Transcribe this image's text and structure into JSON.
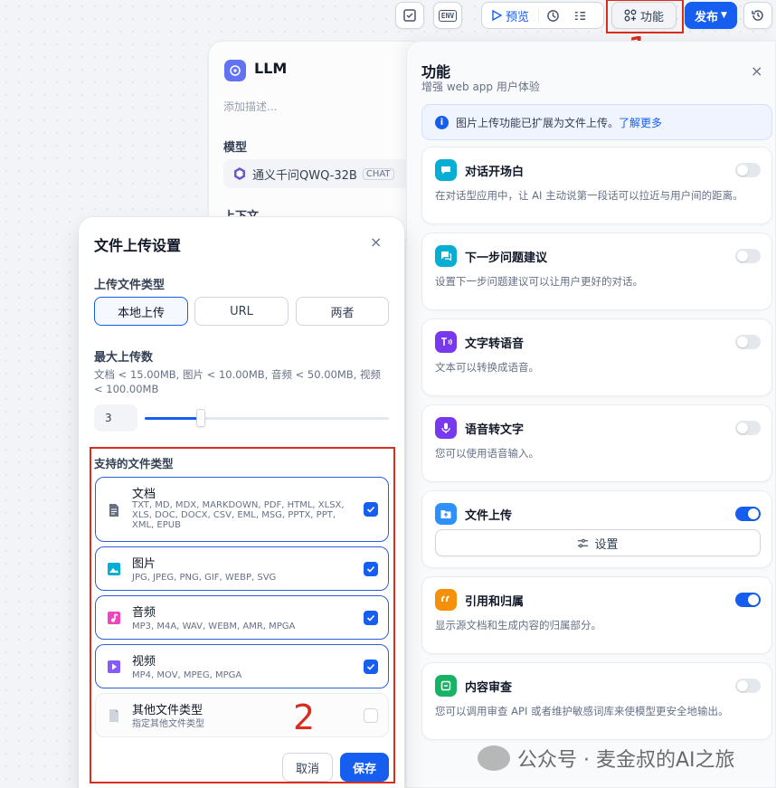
{
  "toolbar": {
    "preview_label": "预览",
    "features_label": "功能",
    "publish_label": "发布",
    "env_label": "ENV"
  },
  "annotations": {
    "n1": "1",
    "n2": "2"
  },
  "llm_node": {
    "title": "LLM",
    "description_placeholder": "添加描述...",
    "model_label": "模型",
    "model_name": "通义千问QWQ-32B",
    "model_badge": "CHAT",
    "context_label": "上下文"
  },
  "upload_modal": {
    "title": "文件上传设置",
    "close": "×",
    "upload_type_label": "上传文件类型",
    "upload_types": [
      "本地上传",
      "URL",
      "两者"
    ],
    "selected_upload_type": "本地上传",
    "max_upload_label": "最大上传数",
    "limit_text": "文档 < 15.00MB, 图片 < 10.00MB, 音频 < 50.00MB, 视频 < 100.00MB",
    "max_upload_value": "3",
    "max_upload_fraction": 0.23,
    "supported_label": "支持的文件类型",
    "file_types": [
      {
        "name": "文档",
        "extensions": "TXT, MD, MDX, MARKDOWN, PDF, HTML, XLSX, XLS, DOC, DOCX, CSV, EML, MSG, PPTX, PPT, XML, EPUB",
        "checked": true,
        "icon": "document-icon",
        "color": "#667085"
      },
      {
        "name": "图片",
        "extensions": "JPG, JPEG, PNG, GIF, WEBP, SVG",
        "checked": true,
        "icon": "image-icon",
        "color": "#06aed4"
      },
      {
        "name": "音频",
        "extensions": "MP3, M4A, WAV, WEBM, AMR, MPGA",
        "checked": true,
        "icon": "audio-icon",
        "color": "#ee46bc"
      },
      {
        "name": "视频",
        "extensions": "MP4, MOV, MPEG, MPGA",
        "checked": true,
        "icon": "video-icon",
        "color": "#875bf7"
      },
      {
        "name": "其他文件类型",
        "extensions": "指定其他文件类型",
        "checked": false,
        "icon": "file-icon",
        "color": "#98a2b3"
      }
    ],
    "cancel_label": "取消",
    "save_label": "保存"
  },
  "features_panel": {
    "title": "功能",
    "subtitle": "增强 web app 用户体验",
    "close": "×",
    "info_text": "图片上传功能已扩展为文件上传。",
    "info_link": "了解更多",
    "features": [
      {
        "title": "对话开场白",
        "description": "在对话型应用中，让 AI 主动说第一段话可以拉近与用户间的距离。",
        "enabled": false,
        "icon": "chat-bubble-icon",
        "color": "#06aed4"
      },
      {
        "title": "下一步问题建议",
        "description": "设置下一步问题建议可以让用户更好的对话。",
        "enabled": false,
        "icon": "message-question-icon",
        "color": "#06aed4"
      },
      {
        "title": "文字转语音",
        "description": "文本可以转换成语音。",
        "enabled": false,
        "icon": "text-to-speech-icon",
        "color": "#7839ee"
      },
      {
        "title": "语音转文字",
        "description": "您可以使用语音输入。",
        "enabled": false,
        "icon": "microphone-icon",
        "color": "#7839ee"
      },
      {
        "title": "文件上传",
        "description": "",
        "enabled": true,
        "icon": "folder-upload-icon",
        "color": "#2e90fa",
        "settings_label": "设置"
      },
      {
        "title": "引用和归属",
        "description": "显示源文档和生成内容的归属部分。",
        "enabled": true,
        "icon": "quote-icon",
        "color": "#f79009"
      },
      {
        "title": "内容审查",
        "description": "您可以调用审查 API 或者维护敏感词库来使模型更安全地输出。",
        "enabled": false,
        "icon": "shield-check-icon",
        "color": "#16b364"
      }
    ]
  },
  "watermark": "公众号 · 麦金叔的AI之旅"
}
